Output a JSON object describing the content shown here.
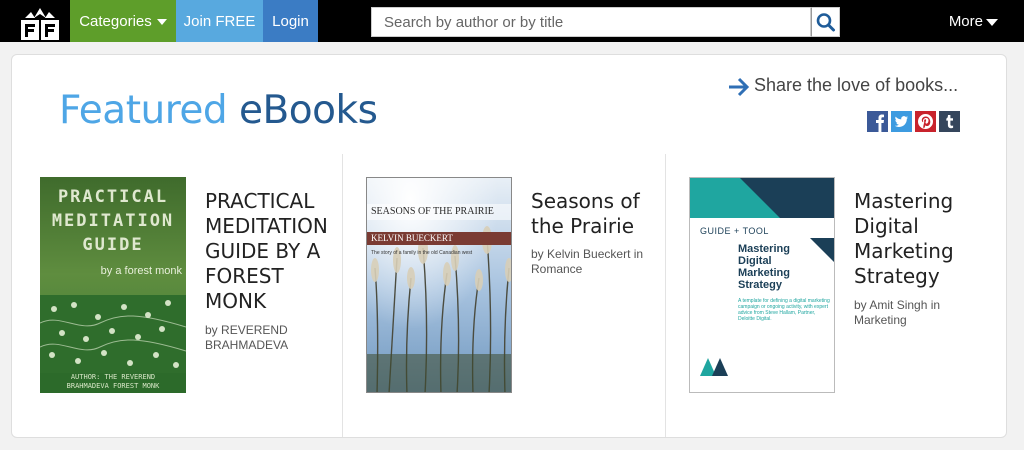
{
  "header": {
    "logo_icon": "open-book-library-icon",
    "categories_label": "Categories",
    "join_label": "Join FREE",
    "login_label": "Login",
    "search_placeholder": "Search by author or by title",
    "search_icon": "search-icon",
    "more_label": "More"
  },
  "featured": {
    "title_part1": "Featured",
    "title_part2": "eBooks",
    "share_text": "Share the love of books...",
    "social": [
      "facebook-icon",
      "twitter-icon",
      "pinterest-icon",
      "tumblr-icon"
    ]
  },
  "books": [
    {
      "title_lines": [
        "PRACTICAL",
        "MEDITATION",
        "GUIDE BY A",
        "FOREST",
        "MONK"
      ],
      "by": "by",
      "author_lines": [
        "REVEREND",
        "BRAHMADEVA"
      ],
      "category": "",
      "cover": {
        "title_lines": [
          "PRACTICAL",
          "MEDITATION",
          "GUIDE"
        ],
        "subtitle": "by a forest monk",
        "footer_lines": [
          "AUTHOR: THE REVEREND",
          "BRAHMADEVA FOREST MONK"
        ]
      }
    },
    {
      "title_lines": [
        "Seasons of",
        "the Prairie"
      ],
      "by": "by",
      "author": "Kelvin Bueckert",
      "in": "in",
      "category": "Romance",
      "cover": {
        "title": "SEASONS OF THE PRAIRIE",
        "author": "KELVIN BUECKERT",
        "tagline": "The story of a family in the old Canadian west"
      }
    },
    {
      "title_lines": [
        "Mastering",
        "Digital",
        "Marketing",
        "Strategy"
      ],
      "by": "by",
      "author": "Amit Singh",
      "in": "in",
      "category": "Marketing",
      "cover": {
        "label": "GUIDE + TOOL",
        "title_lines": [
          "Mastering",
          "Digital",
          "Marketing",
          "Strategy"
        ],
        "blurb": "A template for defining a digital marketing campaign or ongoing activity, with expert advice from Steve Hallam, Partner, Deloitte Digital.",
        "logo": "MA"
      }
    }
  ],
  "colors": {
    "topbar": "#000000",
    "categories": "#5e9e2a",
    "join": "#58a9df",
    "login": "#3b7cc4",
    "title_light": "#4ea6e6",
    "title_dark": "#24598f"
  }
}
